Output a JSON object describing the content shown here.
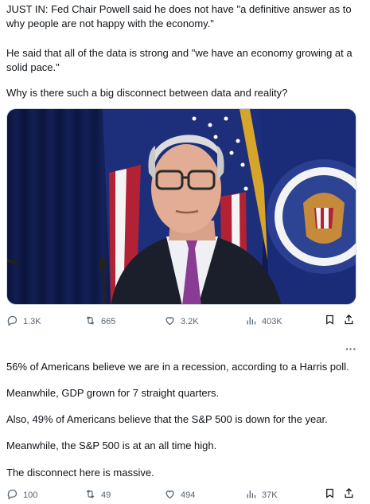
{
  "tweet1": {
    "paragraphs": [
      "JUST IN: Fed Chair Powell said he does not have \"a definitive answer as to why people are not happy with the economy.\"",
      "He said that all of the data is strong and \"we have an economy growing at a solid pace.\"",
      "Why is there such a big disconnect between data and reality?"
    ],
    "stats": {
      "replies": "1.3K",
      "reposts": "665",
      "likes": "3.2K",
      "views": "403K"
    },
    "icons": [
      "reply-icon",
      "repost-icon",
      "like-icon",
      "views-icon",
      "bookmark-icon",
      "share-icon"
    ]
  },
  "tweet2": {
    "more_label": "···",
    "paragraphs": [
      "56% of Americans believe we are in a recession, according to a Harris poll.",
      "Meanwhile, GDP grown for 7 straight quarters.",
      "Also, 49% of Americans believe that the S&P 500 is down for the year.",
      "Meanwhile, the S&P 500 is at an all time high.",
      "The disconnect here is massive."
    ],
    "stats": {
      "replies": "100",
      "reposts": "49",
      "likes": "494",
      "views": "37K"
    }
  },
  "colors": {
    "text": "#0f1419",
    "muted": "#536471",
    "border": "#eff3f4"
  }
}
